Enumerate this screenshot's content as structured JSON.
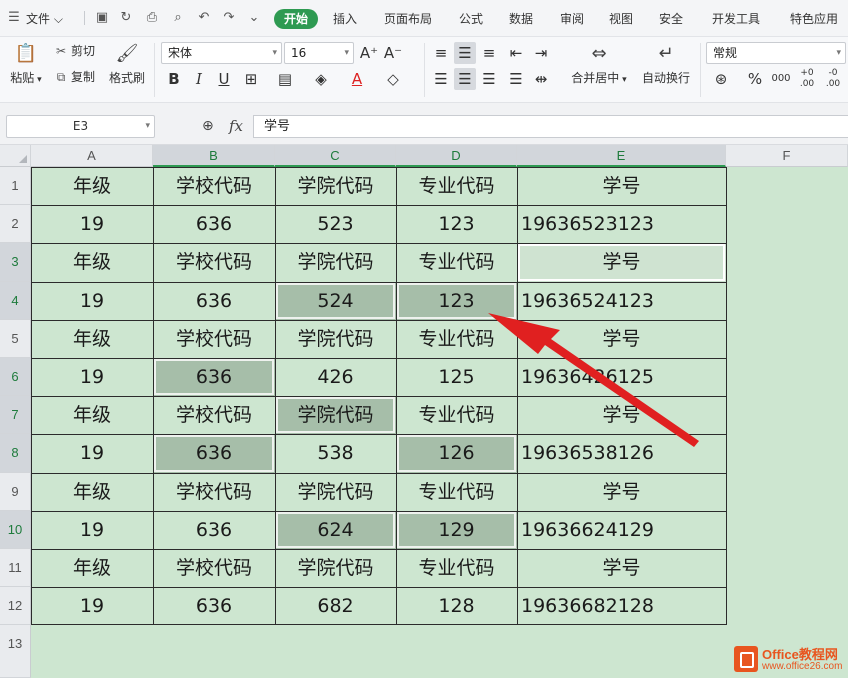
{
  "menu": {
    "file": "文件",
    "tabs": [
      "开始",
      "插入",
      "页面布局",
      "公式",
      "数据",
      "审阅",
      "视图",
      "安全",
      "开发工具",
      "特色应用"
    ],
    "active_tab": "开始"
  },
  "ribbon": {
    "paste": "粘贴",
    "cut": "剪切",
    "copy": "复制",
    "format_painter": "格式刷",
    "font_name": "宋体",
    "font_size": "16",
    "grow_font": "A⁺",
    "shrink_font": "A⁻",
    "bold": "B",
    "italic": "I",
    "underline": "U",
    "merge_center": "合并居中",
    "wrap_text": "自动换行",
    "number_format": "常规",
    "percent": "%",
    "thousands": "000",
    "inc_decimal": "+0 .00",
    "dec_decimal": "-0 .00"
  },
  "formula_bar": {
    "name_box": "E3",
    "fx": "fx",
    "content": "学号"
  },
  "sheet": {
    "columns": [
      "A",
      "B",
      "C",
      "D",
      "E",
      "F"
    ],
    "selected_columns": [
      "B",
      "C",
      "D",
      "E"
    ],
    "rows": [
      "1",
      "2",
      "3",
      "4",
      "5",
      "6",
      "7",
      "8",
      "9",
      "10",
      "11",
      "12",
      "13"
    ],
    "selected_rows": [
      "3",
      "4",
      "6",
      "7",
      "8",
      "10"
    ],
    "active_cell": "E3",
    "cells": [
      [
        "年级",
        "学校代码",
        "学院代码",
        "专业代码",
        "学号"
      ],
      [
        "19",
        "636",
        "523",
        "123",
        "19636523123"
      ],
      [
        "年级",
        "学校代码",
        "学院代码",
        "专业代码",
        "学号"
      ],
      [
        "19",
        "636",
        "524",
        "123",
        "19636524123"
      ],
      [
        "年级",
        "学校代码",
        "学院代码",
        "专业代码",
        "学号"
      ],
      [
        "19",
        "636",
        "426",
        "125",
        "19636426125"
      ],
      [
        "年级",
        "学校代码",
        "学院代码",
        "专业代码",
        "学号"
      ],
      [
        "19",
        "636",
        "538",
        "126",
        "19636538126"
      ],
      [
        "年级",
        "学校代码",
        "学院代码",
        "专业代码",
        "学号"
      ],
      [
        "19",
        "636",
        "624",
        "129",
        "19636624129"
      ],
      [
        "年级",
        "学校代码",
        "学院代码",
        "专业代码",
        "学号"
      ],
      [
        "19",
        "636",
        "682",
        "128",
        "19636682128"
      ]
    ],
    "highlighted_cells": [
      "C4",
      "D4",
      "B6",
      "C7",
      "B8",
      "D8",
      "C10",
      "D10"
    ]
  },
  "colors": {
    "accent": "#2e9a52",
    "sheet_bg": "#cde6d0",
    "highlight": "#a6bea9",
    "arrow": "#e02020"
  },
  "watermark": {
    "title": "Office教程网",
    "url": "www.office26.com"
  }
}
